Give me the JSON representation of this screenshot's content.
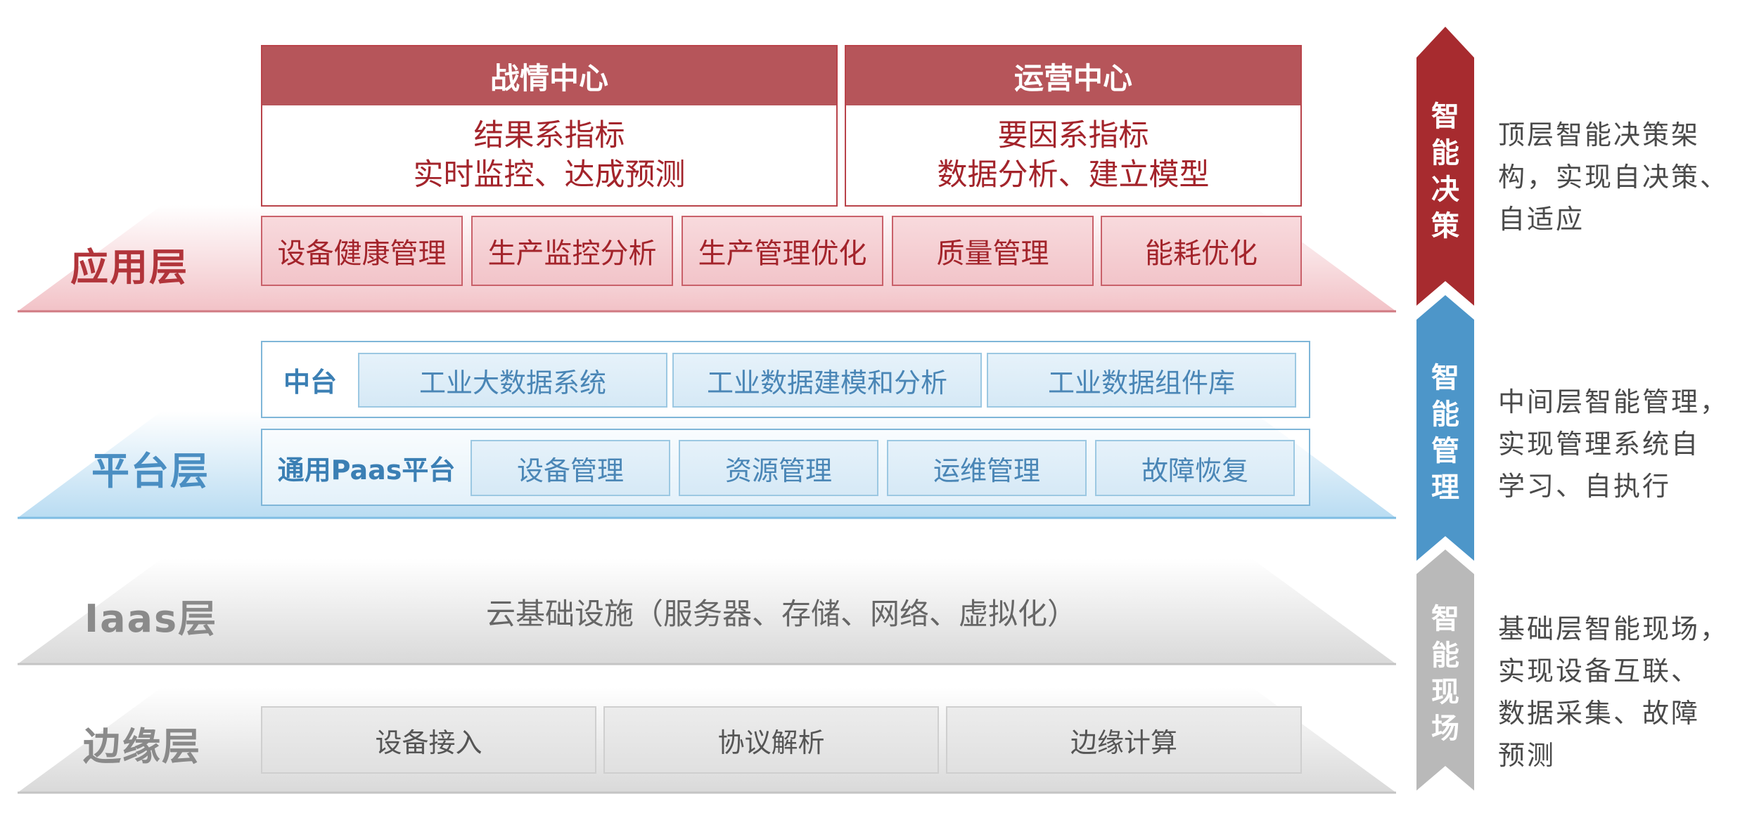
{
  "layers": {
    "app": "应用层",
    "platform": "平台层",
    "iaas": "Iaas层",
    "edge": "边缘层"
  },
  "centers": [
    {
      "title": "战情中心",
      "line1": "结果系指标",
      "line2": "实时监控、达成预测"
    },
    {
      "title": "运营中心",
      "line1": "要因系指标",
      "line2": "数据分析、建立模型"
    }
  ],
  "app_modules": [
    "设备健康管理",
    "生产监控分析",
    "生产管理优化",
    "质量管理",
    "能耗优化"
  ],
  "platform": {
    "middle": {
      "tag": "中台",
      "items": [
        "工业大数据系统",
        "工业数据建模和分析",
        "工业数据组件库"
      ]
    },
    "paas": {
      "tag": "通用Paas平台",
      "items": [
        "设备管理",
        "资源管理",
        "运维管理",
        "故障恢复"
      ]
    }
  },
  "iaas_text": "云基础设施（服务器、存储、网络、虚拟化）",
  "edge_items": [
    "设备接入",
    "协议解析",
    "边缘计算"
  ],
  "intelligence": [
    {
      "label": [
        "智",
        "能",
        "决",
        "策"
      ],
      "color": "#a72b2f",
      "desc": [
        "顶层智能决策架",
        "构，实现自决策、",
        "自适应"
      ]
    },
    {
      "label": [
        "智",
        "能",
        "管",
        "理"
      ],
      "color": "#4d96c9",
      "desc": [
        "中间层智能管理，",
        "实现管理系统自",
        "学习、自执行"
      ]
    },
    {
      "label": [
        "智",
        "能",
        "现",
        "场"
      ],
      "color": "#b9b9b9",
      "desc": [
        "基础层智能现场，",
        "实现设备互联、",
        "数据采集、故障",
        "预测"
      ]
    }
  ]
}
